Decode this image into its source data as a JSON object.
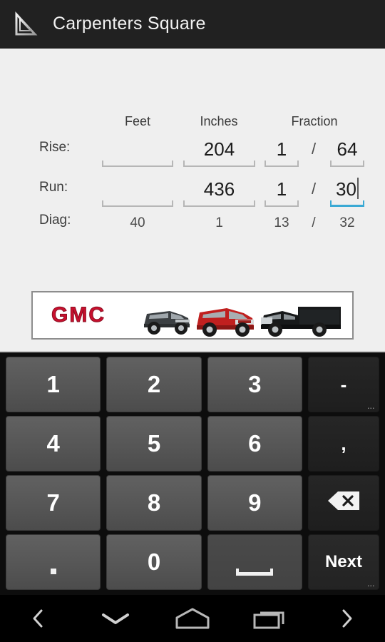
{
  "appbar": {
    "icon": "carpenters-square-icon",
    "title": "Carpenters Square"
  },
  "form": {
    "column_headers": {
      "feet": "Feet",
      "inches": "Inches",
      "fraction": "Fraction"
    },
    "slash": "/",
    "rows": [
      {
        "label": "Rise:",
        "feet": "",
        "inches": "204",
        "fraction_numerator": "1",
        "fraction_denominator": "64",
        "editable": true,
        "focused_field": null
      },
      {
        "label": "Run:",
        "feet": "",
        "inches": "436",
        "fraction_numerator": "1",
        "fraction_denominator": "30",
        "editable": true,
        "focused_field": "fraction_denominator"
      },
      {
        "label": "Diag:",
        "feet": "40",
        "inches": "1",
        "fraction_numerator": "13",
        "fraction_denominator": "32",
        "editable": false,
        "focused_field": null
      }
    ],
    "colors": {
      "background": "#efefef",
      "underline": "#b6b6b6",
      "focus_accent": "#3aa9d4",
      "text": "#1b1b1b"
    }
  },
  "ad": {
    "brand": "GMC",
    "brand_color": "#c8102e",
    "background": "#ffffff",
    "vehicles": [
      "dark-suv",
      "red-suv",
      "black-pickup"
    ]
  },
  "keyboard": {
    "rows": [
      [
        {
          "label": "1",
          "type": "num",
          "name": "key-1"
        },
        {
          "label": "2",
          "type": "num",
          "name": "key-2"
        },
        {
          "label": "3",
          "type": "num",
          "name": "key-3"
        },
        {
          "label": "-",
          "type": "fn",
          "name": "key-minus",
          "hint": "..."
        }
      ],
      [
        {
          "label": "4",
          "type": "num",
          "name": "key-4"
        },
        {
          "label": "5",
          "type": "num",
          "name": "key-5"
        },
        {
          "label": "6",
          "type": "num",
          "name": "key-6"
        },
        {
          "label": ",",
          "type": "fn",
          "name": "key-comma",
          "hint": ""
        }
      ],
      [
        {
          "label": "7",
          "type": "num",
          "name": "key-7"
        },
        {
          "label": "8",
          "type": "num",
          "name": "key-8"
        },
        {
          "label": "9",
          "type": "num",
          "name": "key-9"
        },
        {
          "label": "",
          "type": "fn",
          "name": "key-backspace",
          "icon": "backspace-icon",
          "hint": ""
        }
      ],
      [
        {
          "label": ".",
          "type": "num-dot",
          "name": "key-period"
        },
        {
          "label": "0",
          "type": "num",
          "name": "key-0"
        },
        {
          "label": "",
          "type": "space",
          "name": "key-space",
          "icon": "spacebar-icon"
        },
        {
          "label": "Next",
          "type": "fn",
          "name": "key-next",
          "hint": "..."
        }
      ]
    ],
    "colors": {
      "background": "#0d0d0d",
      "key_face": "#565656",
      "fn_key_face": "#232323",
      "key_text": "#ffffff"
    }
  },
  "navbar": {
    "items": [
      {
        "name": "nav-back-chevron-icon",
        "glyph": "chevron-left"
      },
      {
        "name": "nav-hide-keyboard-icon",
        "glyph": "chevron-down"
      },
      {
        "name": "nav-home-icon",
        "glyph": "home"
      },
      {
        "name": "nav-recents-icon",
        "glyph": "recents"
      },
      {
        "name": "nav-forward-chevron-icon",
        "glyph": "chevron-right"
      }
    ]
  }
}
